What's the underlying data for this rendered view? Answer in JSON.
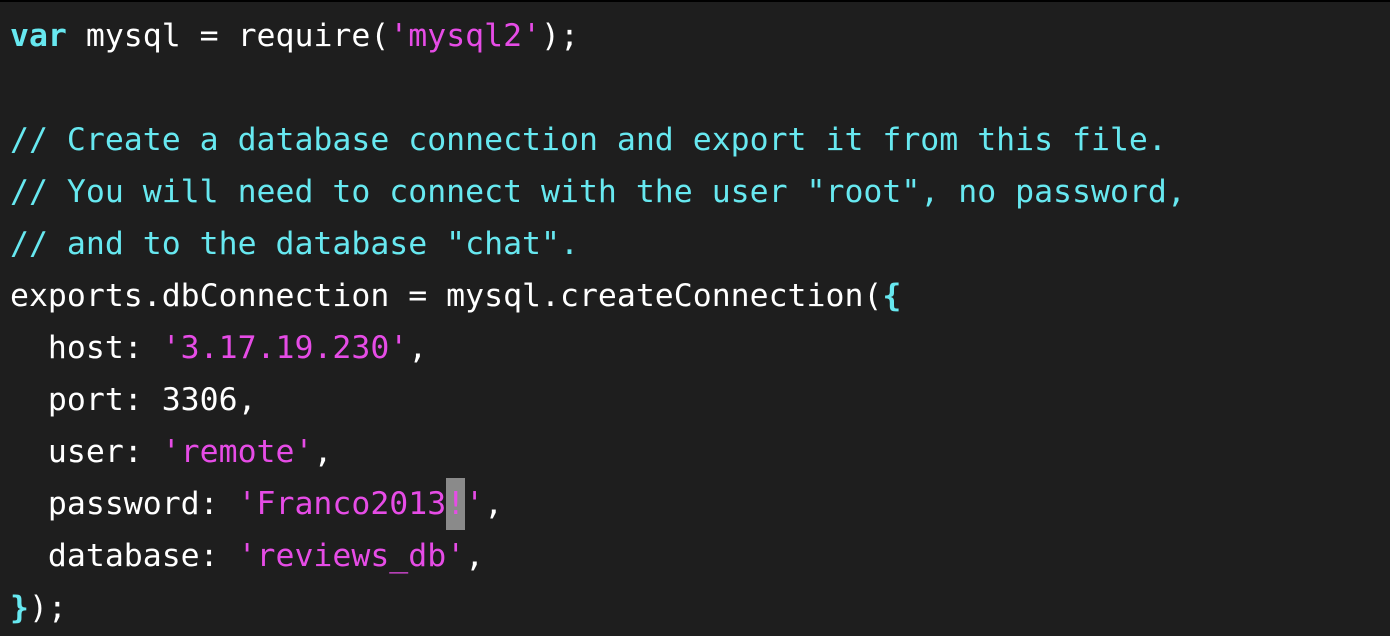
{
  "code_lines": [
    [
      {
        "t": "kw",
        "v": "var"
      },
      {
        "t": "plain",
        "v": " mysql = require("
      },
      {
        "t": "str",
        "v": "'mysql2'"
      },
      {
        "t": "plain",
        "v": ");"
      }
    ],
    [],
    [
      {
        "t": "comment",
        "v": "// Create a database connection and export it from this file."
      }
    ],
    [
      {
        "t": "comment",
        "v": "// You will need to connect with the user \"root\", no password,"
      }
    ],
    [
      {
        "t": "comment",
        "v": "// and to the database \"chat\"."
      }
    ],
    [
      {
        "t": "plain",
        "v": "exports.dbConnection = mysql.createConnection("
      },
      {
        "t": "brace",
        "v": "{"
      }
    ],
    [
      {
        "t": "plain",
        "v": "  host: "
      },
      {
        "t": "str",
        "v": "'3.17.19.230'"
      },
      {
        "t": "plain",
        "v": ","
      }
    ],
    [
      {
        "t": "plain",
        "v": "  port: 3306,"
      }
    ],
    [
      {
        "t": "plain",
        "v": "  user: "
      },
      {
        "t": "str",
        "v": "'remote'"
      },
      {
        "t": "plain",
        "v": ","
      }
    ],
    [
      {
        "t": "plain",
        "v": "  password: "
      },
      {
        "t": "str",
        "v": "'Franco2013"
      },
      {
        "t": "cursor",
        "v": "!"
      },
      {
        "t": "str",
        "v": "'"
      },
      {
        "t": "plain",
        "v": ","
      }
    ],
    [
      {
        "t": "plain",
        "v": "  database: "
      },
      {
        "t": "str",
        "v": "'reviews_db'"
      },
      {
        "t": "plain",
        "v": ","
      }
    ],
    [
      {
        "t": "brace",
        "v": "}"
      },
      {
        "t": "plain",
        "v": ");"
      }
    ]
  ],
  "colors": {
    "background": "#1e1e1e",
    "keyword": "#67e8f0",
    "string": "#e64ce6",
    "comment": "#67e8f0",
    "text": "#ffffff",
    "cursor": "#8a8a8a"
  }
}
